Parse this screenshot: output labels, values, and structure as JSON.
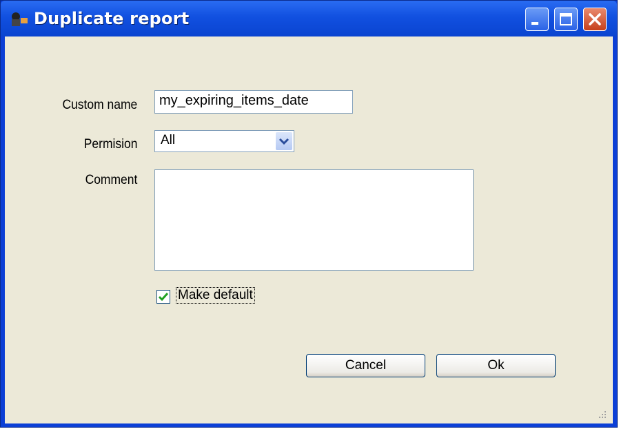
{
  "window": {
    "title": "Duplicate report"
  },
  "form": {
    "custom_name_label": "Custom name",
    "custom_name_value": "my_expiring_items_date",
    "permission_label": "Permision",
    "permission_value": "All",
    "comment_label": "Comment",
    "comment_value": "",
    "make_default_label": "Make default",
    "make_default_checked": true
  },
  "buttons": {
    "cancel": "Cancel",
    "ok": "Ok"
  },
  "icons": {
    "app": "report-app-icon",
    "minimize": "minimize-icon",
    "maximize": "maximize-icon",
    "close": "close-icon",
    "dropdown": "chevron-down-icon",
    "check": "checkmark-icon",
    "resize": "resize-grip-icon"
  },
  "colors": {
    "titlebar": "#0a44d0",
    "client": "#ece9d8",
    "close": "#c6401c",
    "check": "#21a121"
  }
}
